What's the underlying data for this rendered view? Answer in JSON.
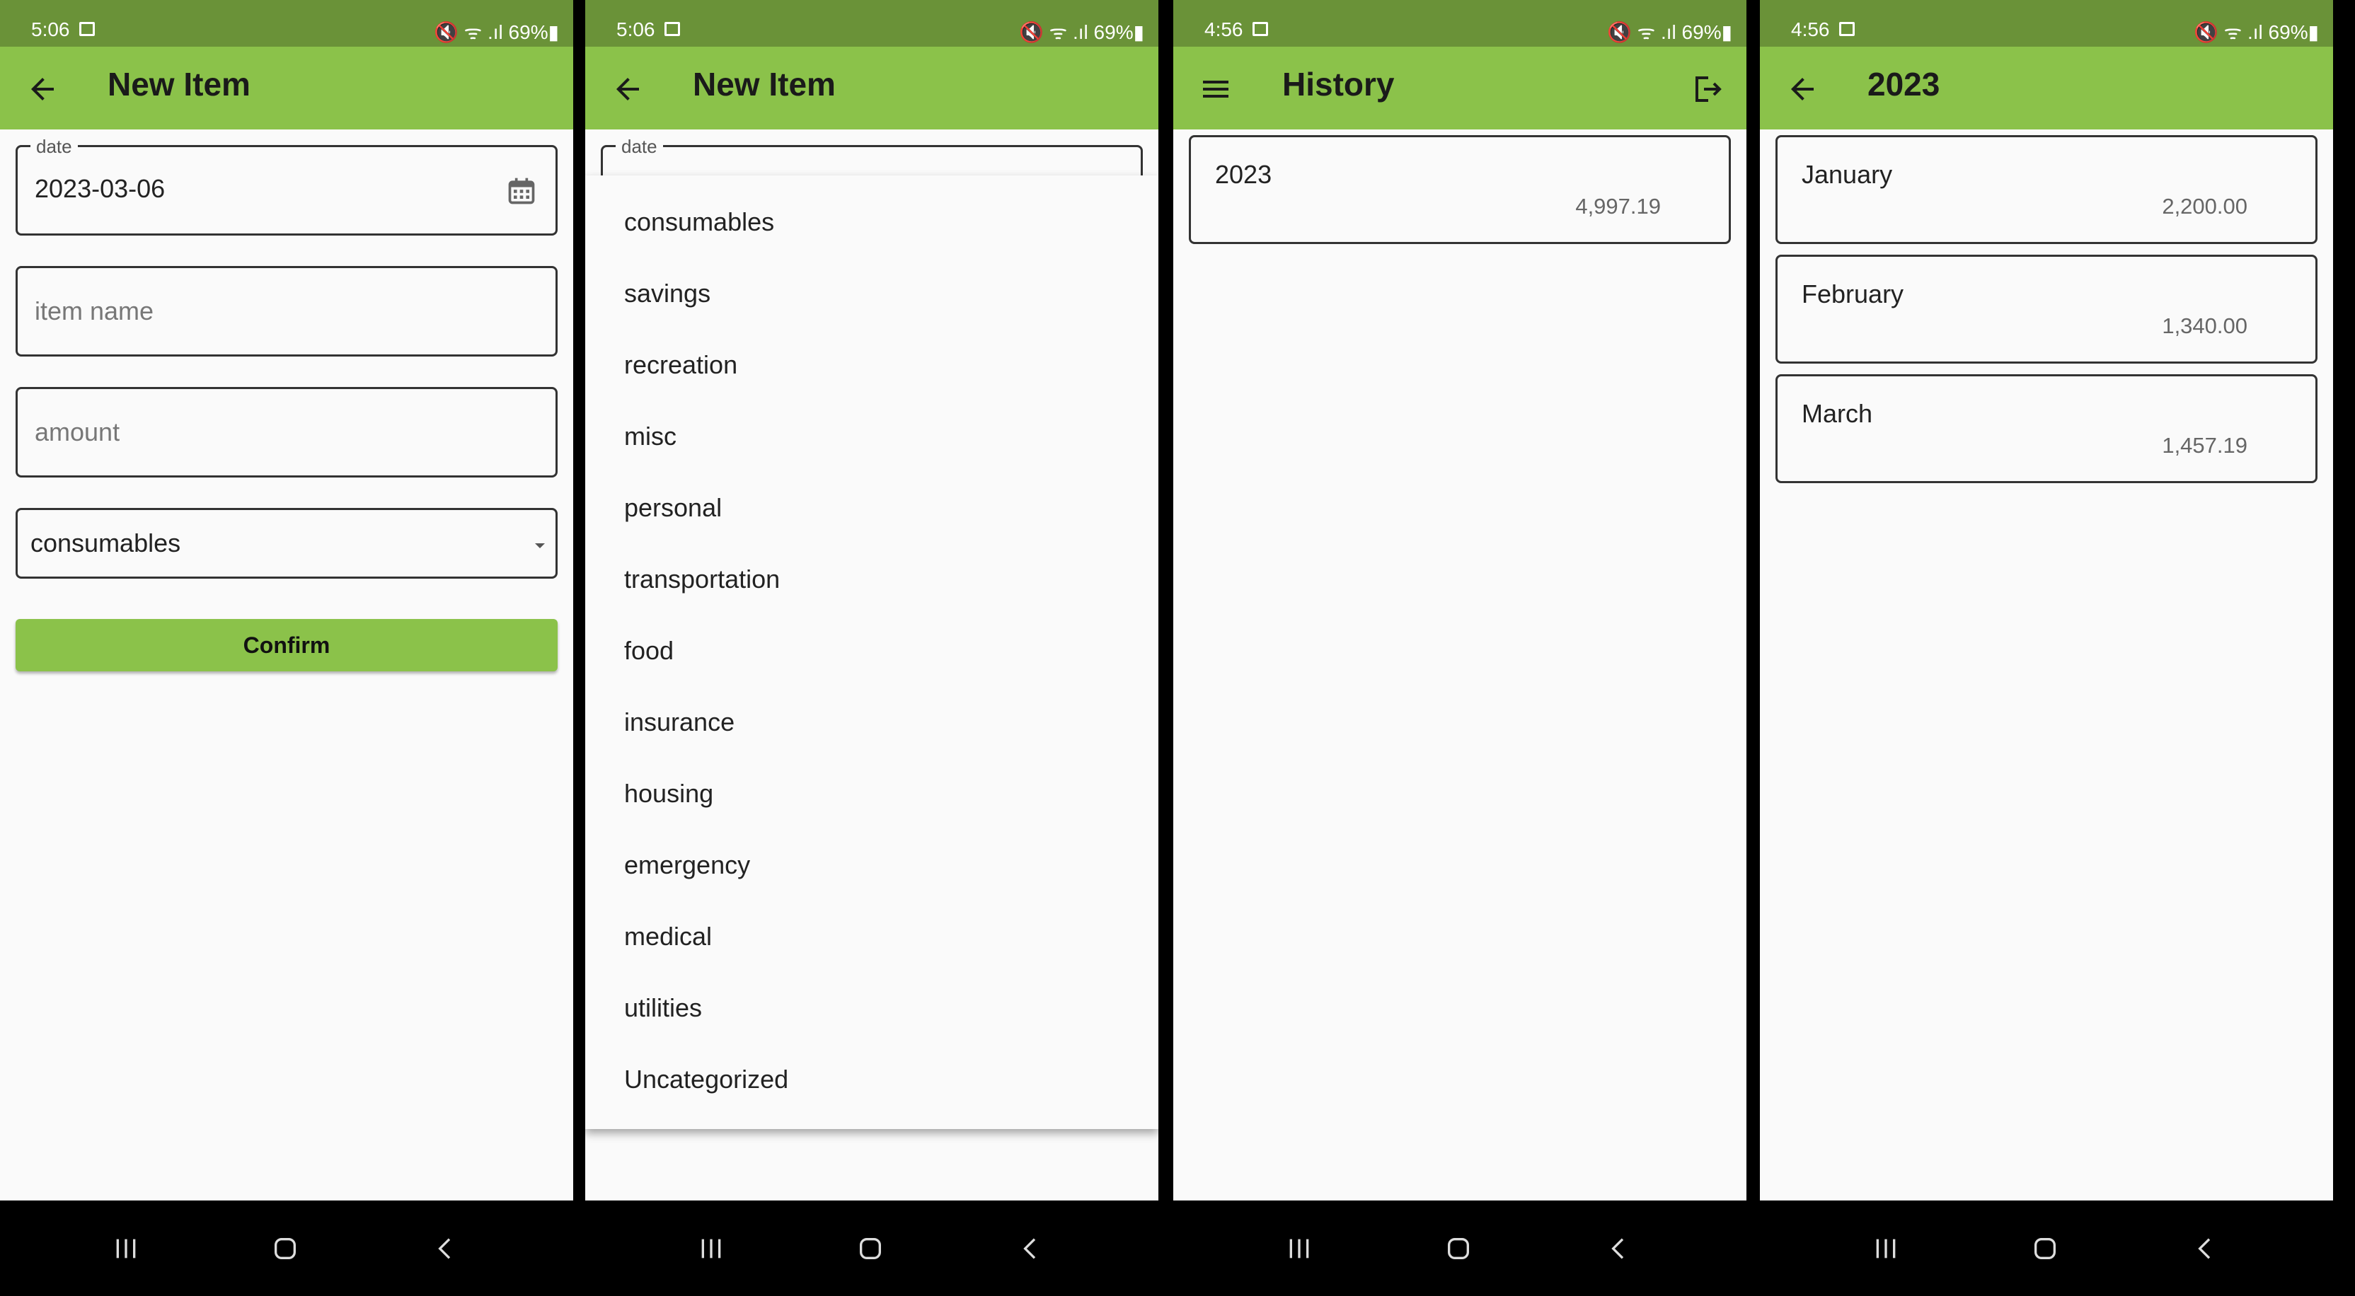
{
  "screens": [
    {
      "status": {
        "time": "5:06",
        "right": "🔇 ᯤ .ıl 69%▮"
      },
      "title": "New Item",
      "form": {
        "date_label": "date",
        "date_value": "2023-03-06",
        "item_name_placeholder": "item name",
        "amount_placeholder": "amount",
        "category_value": "consumables",
        "confirm_label": "Confirm"
      }
    },
    {
      "status": {
        "time": "5:06",
        "right": "🔇 ᯤ .ıl 69%▮"
      },
      "title": "New Item",
      "date_label": "date",
      "menu_items": [
        "consumables",
        "savings",
        "recreation",
        "misc",
        "personal",
        "transportation",
        "food",
        "insurance",
        "housing",
        "emergency",
        "medical",
        "utilities",
        "Uncategorized"
      ]
    },
    {
      "status": {
        "time": "4:56",
        "right": "🔇 ᯤ .ıl 69%▮"
      },
      "title": "History",
      "cards": [
        {
          "title": "2023",
          "amount": "4,997.19"
        }
      ]
    },
    {
      "status": {
        "time": "4:56",
        "right": "🔇 ᯤ .ıl 69%▮"
      },
      "title": "2023",
      "cards": [
        {
          "title": "January",
          "amount": "2,200.00"
        },
        {
          "title": "February",
          "amount": "1,340.00"
        },
        {
          "title": "March",
          "amount": "1,457.19"
        }
      ]
    }
  ],
  "icons": {
    "back": "arrow-left-icon",
    "menu": "hamburger-menu-icon",
    "logout": "logout-icon",
    "calendar": "calendar-icon",
    "dropdown": "caret-down-icon",
    "nav_recents": "recent-apps-icon",
    "nav_home": "home-icon",
    "nav_back": "nav-back-icon"
  },
  "colors": {
    "appbar": "#8bc24a",
    "statusbar": "#6a9238",
    "background": "#fafafa"
  }
}
